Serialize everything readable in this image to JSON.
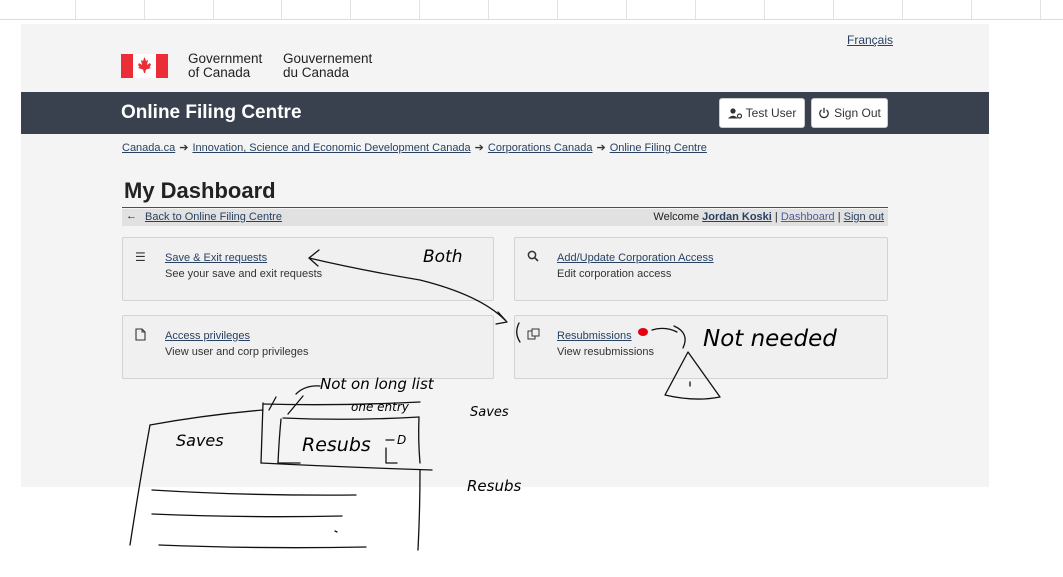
{
  "language_toggle": "Français",
  "signature": {
    "en_line1": "Government",
    "en_line2": "of Canada",
    "fr_line1": "Gouvernement",
    "fr_line2": "du Canada"
  },
  "header": {
    "title": "Online Filing Centre",
    "user_button": "Test User",
    "signout_button": "Sign Out"
  },
  "breadcrumbs": [
    "Canada.ca",
    "Innovation, Science and Economic Development Canada",
    "Corporations Canada",
    "Online Filing Centre"
  ],
  "page_title": "My Dashboard",
  "subbar": {
    "back_link": "Back to Online Filing Centre",
    "welcome": "Welcome",
    "user_name": "Jordan Koski",
    "dashboard_link": "Dashboard",
    "signout_link": "Sign out",
    "sep": "|"
  },
  "cards": [
    {
      "title": "Save & Exit requests",
      "desc": "See your save and exit requests",
      "icon": "list-icon"
    },
    {
      "title": "Add/Update Corporation Access",
      "desc": "Edit corporation access",
      "icon": "search-icon"
    },
    {
      "title": "Access privileges",
      "desc": "View user and corp privileges",
      "icon": "document-icon"
    },
    {
      "title": "Resubmissions",
      "desc": "View resubmissions",
      "icon": "copy-icon"
    }
  ],
  "annotations": {
    "both": "Both",
    "not_needed": "Not needed",
    "not_on_long_list": "Not on long list",
    "one_entry": "one entry",
    "saves_left": "Saves",
    "resubs": "Resubs",
    "saves_right": "Saves",
    "resubs_right": "Resubs",
    "d_note": "D"
  },
  "colors": {
    "navbar": "#38414d",
    "link": "#284162",
    "flag_red": "#eb2d37",
    "rule_red": "#a62a1e"
  }
}
